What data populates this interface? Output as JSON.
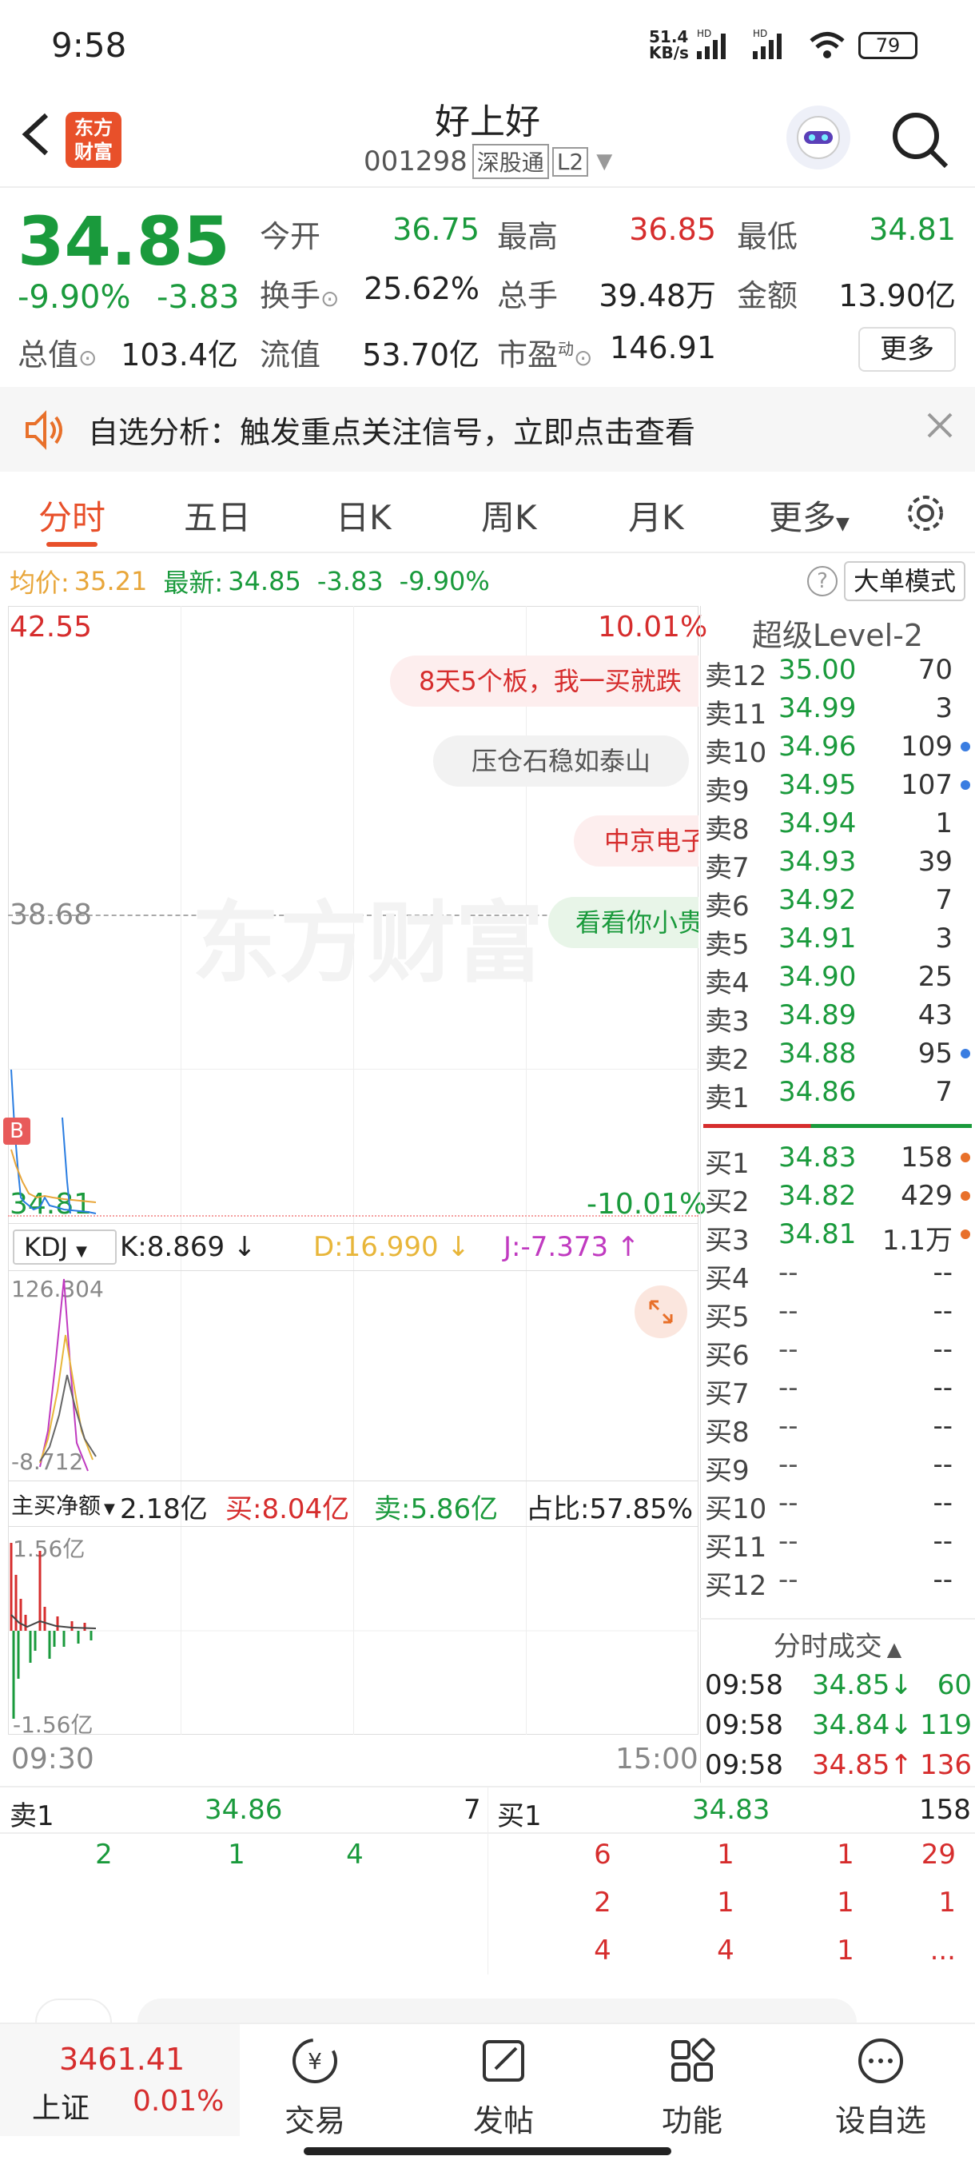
{
  "status": {
    "time": "9:58",
    "net_speed": "51.4",
    "net_unit": "KB/s",
    "battery": "79"
  },
  "header": {
    "title": "好上好",
    "code": "001298",
    "tag1": "深股通",
    "tag2": "L2",
    "logo_line1": "东方",
    "logo_line2": "财富"
  },
  "quote": {
    "price": "34.85",
    "change_pct": "-9.90%",
    "change": "-3.83",
    "open_label": "今开",
    "open": "36.75",
    "high_label": "最高",
    "high": "36.85",
    "low_label": "最低",
    "low": "34.81",
    "turnover_label": "换手",
    "turnover": "25.62%",
    "volume_label": "总手",
    "volume": "39.48万",
    "amount_label": "金额",
    "amount": "13.90亿",
    "mktcap_label": "总值",
    "mktcap": "103.4亿",
    "float_label": "流值",
    "float": "53.70亿",
    "pe_label": "市盈",
    "pe_sup": "动",
    "pe": "146.91",
    "more_label": "更多"
  },
  "notice": {
    "text": "自选分析：触发重点关注信号，立即点击查看"
  },
  "tabs": [
    "分时",
    "五日",
    "日K",
    "周K",
    "月K",
    "更多"
  ],
  "chart_info": {
    "avg_label": "均价:",
    "avg": "35.21",
    "latest_label": "最新:",
    "latest": "34.85",
    "chg": "-3.83",
    "pct": "-9.90%",
    "mode_button": "大单模式"
  },
  "chart": {
    "ymax": "42.55",
    "ymax_pct": "10.01%",
    "ymid": "38.68",
    "ymin": "34.81",
    "ymin_pct": "-10.01%",
    "watermark": "东方财富",
    "b_marker": "B",
    "bubbles": [
      "8天5个板，我一买就跌",
      "压仓石稳如泰山",
      "中京电子",
      "看看你小贵"
    ]
  },
  "kdj": {
    "select": "KDJ",
    "k": "K:8.869 ↓",
    "d": "D:16.990 ↓",
    "j": "J:-7.373 ↑",
    "top": "126.304",
    "bottom": "-8.712"
  },
  "flow": {
    "select": "主买净额",
    "net": "2.18亿",
    "buy": "买:8.04亿",
    "sell": "卖:5.86亿",
    "ratio": "占比:57.85%",
    "top": "1.56亿",
    "bottom": "-1.56亿"
  },
  "time_axis": {
    "start": "09:30",
    "end": "15:00"
  },
  "level2": {
    "title": "超级Level-2",
    "asks": [
      {
        "label": "卖12",
        "price": "35.00",
        "vol": "70",
        "dot": ""
      },
      {
        "label": "卖11",
        "price": "34.99",
        "vol": "3",
        "dot": ""
      },
      {
        "label": "卖10",
        "price": "34.96",
        "vol": "109",
        "dot": "blue"
      },
      {
        "label": "卖9",
        "price": "34.95",
        "vol": "107",
        "dot": "blue"
      },
      {
        "label": "卖8",
        "price": "34.94",
        "vol": "1",
        "dot": ""
      },
      {
        "label": "卖7",
        "price": "34.93",
        "vol": "39",
        "dot": ""
      },
      {
        "label": "卖6",
        "price": "34.92",
        "vol": "7",
        "dot": ""
      },
      {
        "label": "卖5",
        "price": "34.91",
        "vol": "3",
        "dot": ""
      },
      {
        "label": "卖4",
        "price": "34.90",
        "vol": "25",
        "dot": ""
      },
      {
        "label": "卖3",
        "price": "34.89",
        "vol": "43",
        "dot": ""
      },
      {
        "label": "卖2",
        "price": "34.88",
        "vol": "95",
        "dot": "blue"
      },
      {
        "label": "卖1",
        "price": "34.86",
        "vol": "7",
        "dot": ""
      }
    ],
    "bids": [
      {
        "label": "买1",
        "price": "34.83",
        "vol": "158",
        "dot": "orange"
      },
      {
        "label": "买2",
        "price": "34.82",
        "vol": "429",
        "dot": "orange"
      },
      {
        "label": "买3",
        "price": "34.81",
        "vol": "1.1万",
        "dot": "orange"
      },
      {
        "label": "买4",
        "price": "--",
        "vol": "--",
        "dot": ""
      },
      {
        "label": "买5",
        "price": "--",
        "vol": "--",
        "dot": ""
      },
      {
        "label": "买6",
        "price": "--",
        "vol": "--",
        "dot": ""
      },
      {
        "label": "买7",
        "price": "--",
        "vol": "--",
        "dot": ""
      },
      {
        "label": "买8",
        "price": "--",
        "vol": "--",
        "dot": ""
      },
      {
        "label": "买9",
        "price": "--",
        "vol": "--",
        "dot": ""
      },
      {
        "label": "买10",
        "price": "--",
        "vol": "--",
        "dot": ""
      },
      {
        "label": "买11",
        "price": "--",
        "vol": "--",
        "dot": ""
      },
      {
        "label": "买12",
        "price": "--",
        "vol": "--",
        "dot": ""
      }
    ],
    "ticks_title": "分时成交",
    "ticks": [
      {
        "time": "09:58",
        "price": "34.85↓",
        "vol": "60"
      },
      {
        "time": "09:58",
        "price": "34.84↓",
        "vol": "119"
      },
      {
        "time": "09:58",
        "price": "34.85↑",
        "vol": "136"
      }
    ]
  },
  "queue": {
    "sell_label": "卖1",
    "sell_price": "34.86",
    "sell_vol": "7",
    "buy_label": "买1",
    "buy_price": "34.83",
    "buy_vol": "158",
    "sell_rows": [
      [
        "2",
        "1",
        "4"
      ]
    ],
    "buy_rows": [
      [
        "6",
        "1",
        "1",
        "29"
      ],
      [
        "2",
        "1",
        "1",
        "1"
      ],
      [
        "4",
        "4",
        "1",
        "..."
      ]
    ]
  },
  "tabbar": {
    "index_price": "3461.41",
    "index_name": "上证",
    "index_pct": "0.01%",
    "items": [
      "交易",
      "发帖",
      "功能",
      "设自选"
    ]
  }
}
